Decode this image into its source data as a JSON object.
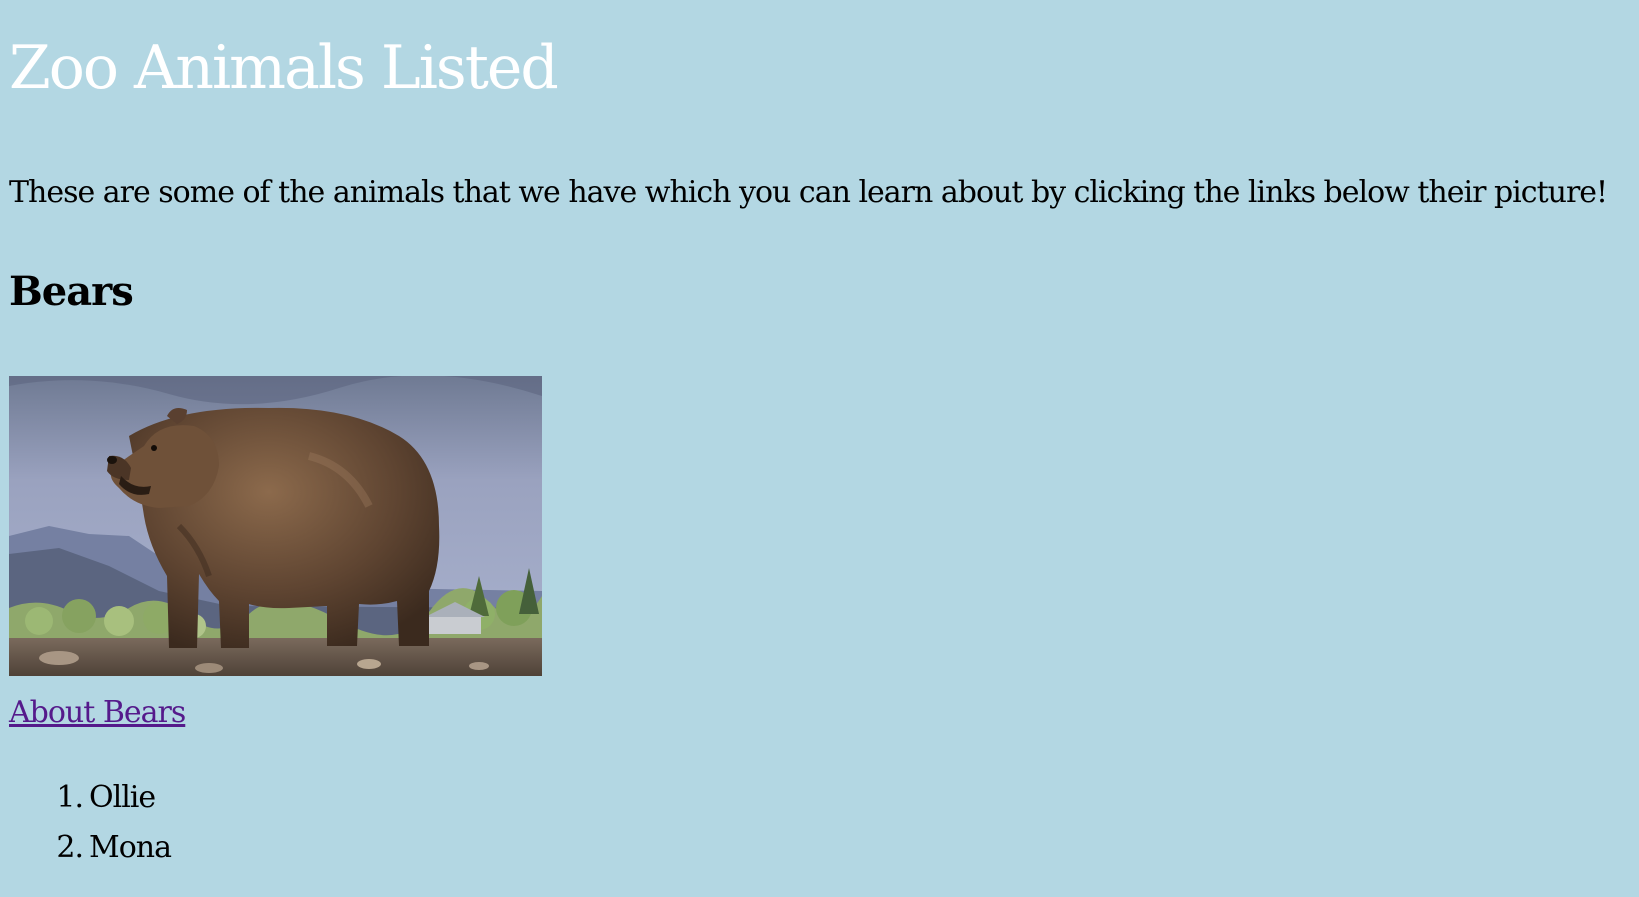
{
  "page": {
    "title": "Zoo Animals Listed",
    "intro": "These are some of the animals that we have which you can learn about by clicking the links below their picture!"
  },
  "sections": [
    {
      "heading": "Bears",
      "image_icon": "bear-photo",
      "link_label": "About Bears",
      "names": [
        {
          "number": "1.",
          "name": "Ollie"
        },
        {
          "number": "2.",
          "name": "Mona"
        }
      ]
    }
  ],
  "colors": {
    "background": "#b3d7e3",
    "title": "#ffffff",
    "text": "#000000",
    "visited_link": "#551a8b"
  }
}
